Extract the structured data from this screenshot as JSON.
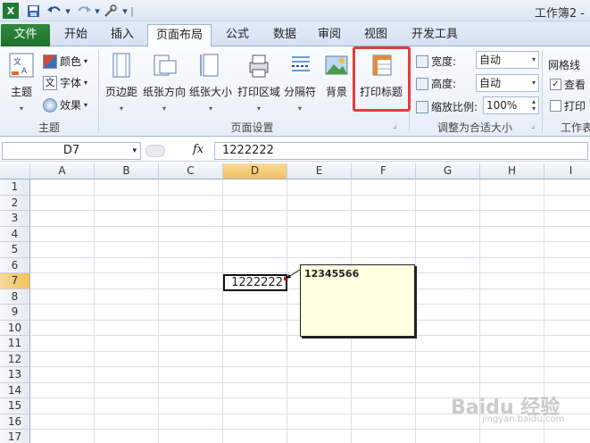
{
  "window": {
    "title": "工作簿2 -"
  },
  "quick_access": {
    "save_icon": "save-icon",
    "undo_icon": "undo-icon",
    "redo_icon": "redo-icon"
  },
  "tabs": [
    {
      "label": "文件"
    },
    {
      "label": "开始"
    },
    {
      "label": "插入"
    },
    {
      "label": "页面布局"
    },
    {
      "label": "公式"
    },
    {
      "label": "数据"
    },
    {
      "label": "审阅"
    },
    {
      "label": "视图"
    },
    {
      "label": "开发工具"
    }
  ],
  "ribbon": {
    "theme_group": {
      "label": "主题",
      "theme_button": "主题",
      "colors": "颜色",
      "fonts": "字体",
      "effects": "效果"
    },
    "page_setup_group": {
      "label": "页面设置",
      "margins": "页边距",
      "orientation": "纸张方向",
      "size": "纸张大小",
      "print_area": "打印区域",
      "breaks": "分隔符",
      "background": "背景",
      "print_titles": "打印标题"
    },
    "scale_group": {
      "label": "调整为合适大小",
      "width_label": "宽度:",
      "width_value": "自动",
      "height_label": "高度:",
      "height_value": "自动",
      "scale_label": "缩放比例:",
      "scale_value": "100%"
    },
    "sheet_options_group": {
      "label": "工作表",
      "gridlines": "网格线",
      "view": "查看",
      "print": "打印"
    }
  },
  "formula_bar": {
    "name_box": "D7",
    "fx": "fx",
    "formula": "1222222"
  },
  "columns": [
    "A",
    "B",
    "C",
    "D",
    "E",
    "F",
    "G",
    "H",
    "I"
  ],
  "rows": [
    "1",
    "2",
    "3",
    "4",
    "5",
    "6",
    "7",
    "8",
    "9",
    "10",
    "11",
    "12",
    "13",
    "14",
    "15",
    "16",
    "17"
  ],
  "selected": {
    "column": "D",
    "row": "7"
  },
  "cell_d7": "1222222",
  "comment": "12345566",
  "watermark": {
    "main": "Baidu 经验",
    "sub": "jingyan.baidu.com"
  },
  "colors": {
    "file_tab": "#2E8A3C",
    "highlight": "#E53C3C",
    "comment_bg": "#FFFFE1",
    "selected_header": "#F1C15F"
  }
}
